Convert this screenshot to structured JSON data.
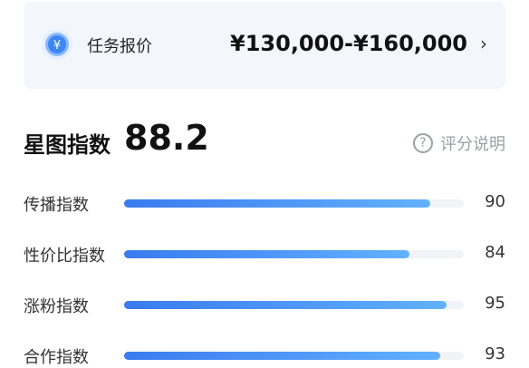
{
  "price": {
    "label": "任务报价",
    "range": "¥130,000-¥160,000",
    "chevron": "›",
    "icon_symbol": "¥",
    "icon": "yen-coin-icon"
  },
  "score": {
    "title": "星图指数",
    "value": "88.2",
    "help_label": "评分说明",
    "help_icon_symbol": "?",
    "help_icon": "question-circle-icon"
  },
  "metrics": [
    {
      "label": "传播指数",
      "value": "90",
      "level": 90
    },
    {
      "label": "性价比指数",
      "value": "84",
      "level": 84
    },
    {
      "label": "涨粉指数",
      "value": "95",
      "level": 95
    },
    {
      "label": "合作指数",
      "value": "93",
      "level": 93
    }
  ],
  "colors": {
    "bar_start": "#3a7bef",
    "bar_end": "#62b1ff",
    "card_bg": "#f3f7fc"
  }
}
